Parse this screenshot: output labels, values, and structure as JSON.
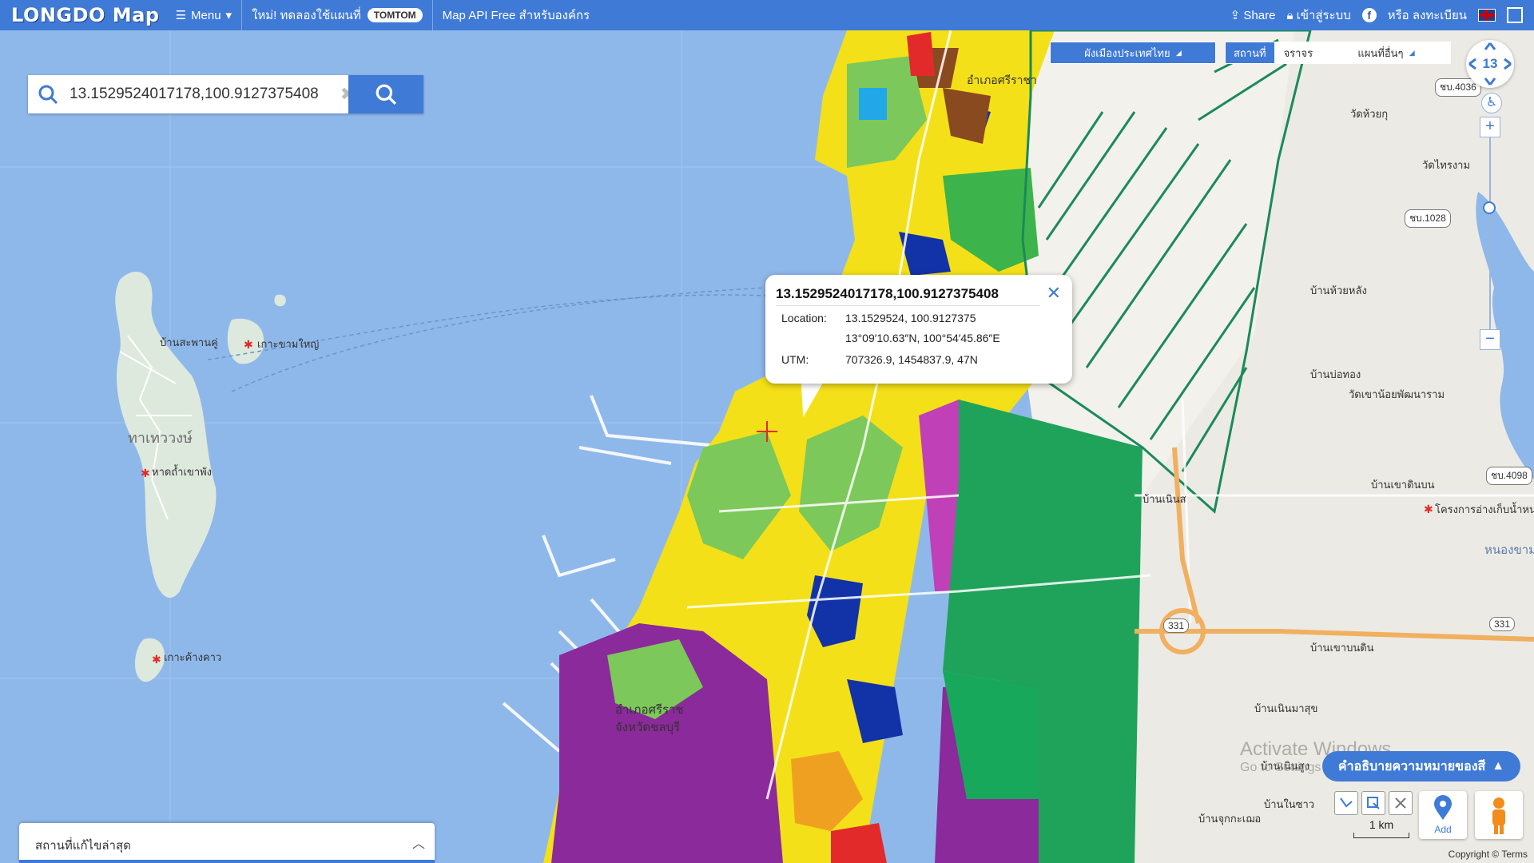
{
  "topbar": {
    "logo": "LONGDO Map",
    "menu_label": "Menu",
    "promo_text": "ใหม่! ทดลองใช้แผนที่",
    "tomtom_label": "TOMTOM",
    "api_text": "Map API Free สำหรับองค์กร",
    "share_label": "Share",
    "login_label": "เข้าสู่ระบบ",
    "register_label": "หรือ ลงทะเบียน"
  },
  "search": {
    "value": "13.1529524017178,100.9127375408"
  },
  "layers": {
    "city_plan_label": "ผังเมืองประเทศไทย",
    "place_tab": "สถานที่",
    "traffic_tab": "จราจร",
    "other_maps_label": "แผนที่อื่นๆ"
  },
  "navigation": {
    "zoom_level": "13",
    "zoom_in": "+",
    "zoom_out": "−"
  },
  "popup": {
    "title": "13.1529524017178,100.9127375408",
    "location_label": "Location:",
    "location_decimal": "13.1529524, 100.9127375",
    "location_dms": "13°09′10.63″N, 100°54′45.86″E",
    "utm_label": "UTM:",
    "utm_value": "707326.9, 1454837.9, 47N"
  },
  "map_labels": {
    "chaloem_area": "ทาเทววงษ์",
    "ban_sa_pan": "บ้านสะพานคู่",
    "ko_kham_yai": "เกาะขามใหญ่",
    "hat_tham_phang": "หาดถ้ำเขาพัง",
    "ko_khang_khao": "เกาะค้างคาว",
    "amphoe_sriracha": "อำเภอศรีราชา",
    "amphoe_sriracha_2": "อำเภอศรีราช",
    "changwat_chonburi": "จังหวัดชลบุรี",
    "wat_huai_ku": "วัดห้วยกุ",
    "wat_phrong": "วัดไทรงาม",
    "ban_huai_lang": "บ้านห้วยหลัง",
    "ban_bo_thong": "บ้านบ่อทอง",
    "wat_khao_noi": "วัดเขาน้อยพัฒนาราม",
    "ban_khao_din": "บ้านเขาดินบน",
    "khrongkan": "โครงการอ่างเก็บน้ำหน",
    "nong_kham": "หนองขาม",
    "ban_khao_ban_din": "บ้านเขาบนดิน",
    "ban_noen_sai": "บ้านเนินมาสุข",
    "ban_noen_sung": "บ้านเนินสูง",
    "ban_na_sao": "บ้านในซาว",
    "ban_chuk": "บ้านจุกกะเฌอ",
    "ban_noen": "บ้านเนินส",
    "rd_4036": "ชบ.4036",
    "rd_1028": "ชบ.1028",
    "rd_4098": "ชบ.4098",
    "rd_331a": "331",
    "rd_331b": "331"
  },
  "bottom": {
    "recent_label": "สถานที่แก้ไขล่าสุด",
    "legend_label": "คำอธิบายความหมายของสี",
    "add_label": "Add",
    "scale_label": "1 km",
    "copyright": "Copyright © Terms"
  },
  "watermark": {
    "line1": "Activate Windows",
    "line2": "Go to Settings to activate Windows."
  },
  "colors": {
    "brand_blue": "#3f7ad6",
    "sea": "#8fb8ea",
    "residential_yellow": "#f4e018",
    "industrial_purple": "#8b2a9a",
    "agri_green": "#1fa35a",
    "institution_blue": "#1232a8"
  }
}
